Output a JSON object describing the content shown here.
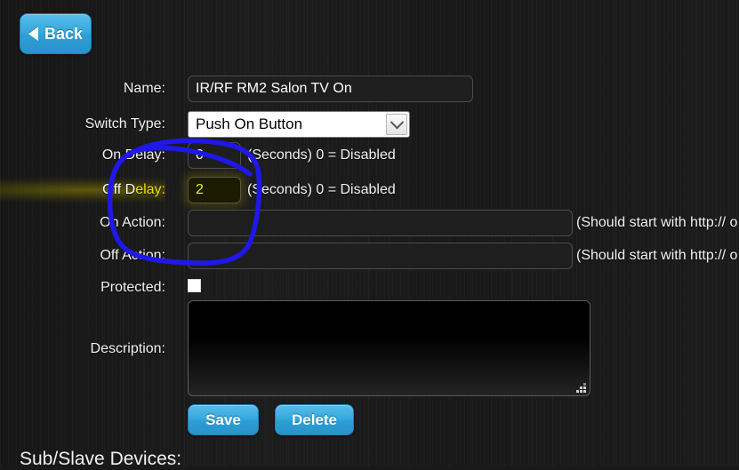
{
  "window": {
    "background_color": "#1b1b1b",
    "accent_color": "#36a9de",
    "highlight_color": "#efef1a"
  },
  "nav": {
    "back_label": "Back",
    "back_icon": "triangle-left-icon"
  },
  "form": {
    "rows": [
      {
        "label": "Name:",
        "value": "IR/RF RM2 Salon TV On",
        "hint": ""
      },
      {
        "label": "Switch Type:",
        "value": "Push On Button",
        "hint": ""
      },
      {
        "label": "On Delay:",
        "value": "0",
        "hint": "(Seconds) 0 = Disabled"
      },
      {
        "label": "Off Delay:",
        "value": "2",
        "hint": "(Seconds) 0 = Disabled"
      },
      {
        "label": "On Action:",
        "value": "",
        "hint": "(Should start with http:// o"
      },
      {
        "label": "Off Action:",
        "value": "",
        "hint": "(Should start with http:// o"
      },
      {
        "label": "Protected:",
        "value": "",
        "hint": ""
      },
      {
        "label": "Description:",
        "value": "",
        "hint": ""
      }
    ],
    "switch_type_selected": "Push On Button",
    "switch_type_icon": "chevron-down-icon",
    "protected_checked": false,
    "description_value": ""
  },
  "buttons": {
    "save_label": "Save",
    "delete_label": "Delete"
  },
  "sections": {
    "sub_slave_heading": "Sub/Slave Devices:"
  },
  "annotation": {
    "type": "freehand-circle",
    "color": "#1f18e8",
    "encircles": "On Delay and Off Delay fields"
  }
}
